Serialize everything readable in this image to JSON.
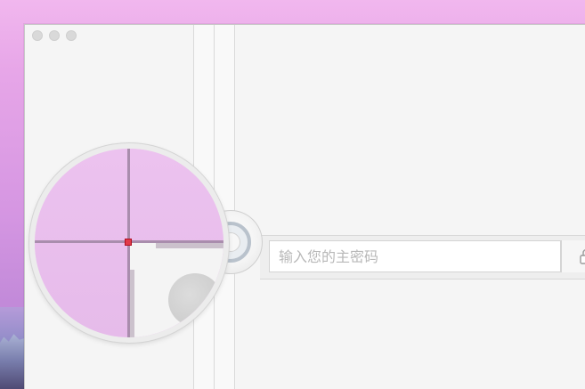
{
  "window": {
    "traffic_lights": [
      "close-icon",
      "minimize-icon",
      "zoom-icon"
    ]
  },
  "unlock": {
    "icon": "unlock-ring-icon"
  },
  "password": {
    "placeholder": "输入您的主密码",
    "value": "",
    "lock_icon": "lock-icon"
  },
  "loupe": {
    "icon": "magnifier-crosshair"
  },
  "colors": {
    "desktop_accent": "#e7a6e8",
    "window_bg": "#f5f5f5",
    "loupe_crosshair_pixel": "#e03a4a"
  }
}
